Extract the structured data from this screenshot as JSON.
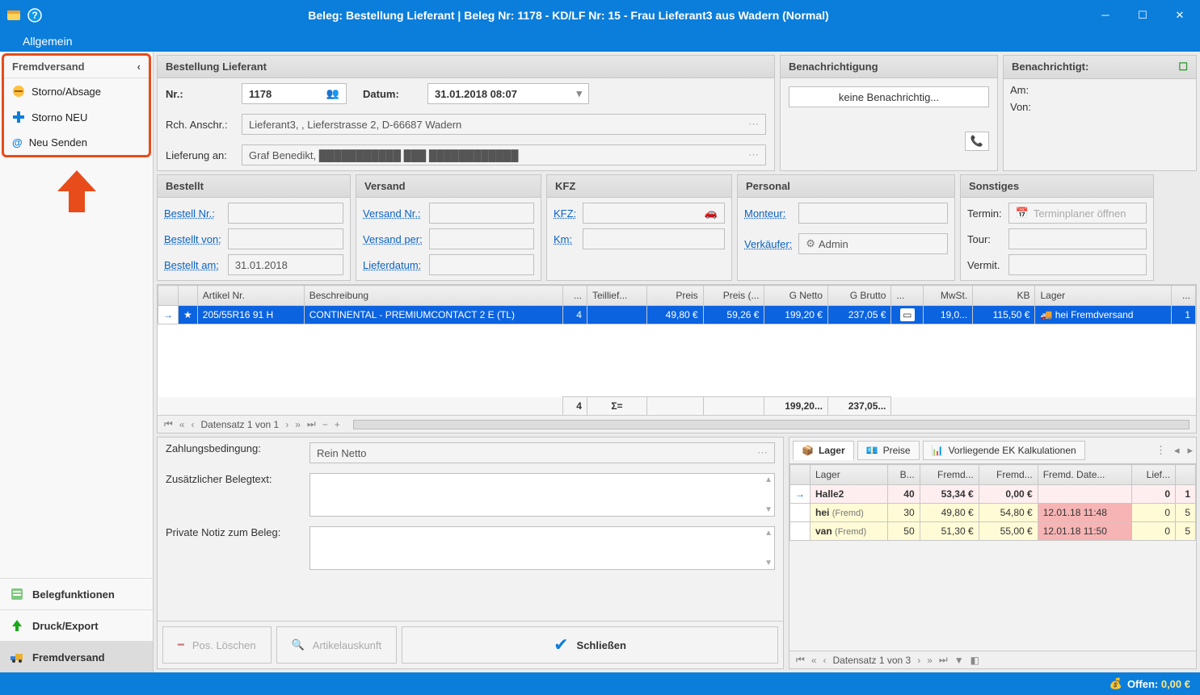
{
  "titlebar": {
    "title": "Beleg: Bestellung Lieferant  |  Beleg Nr: 1178 -  KD/LF Nr: 15 - Frau Lieferant3  aus Wadern (Normal)"
  },
  "ribbon": {
    "tab_general": "Allgemein"
  },
  "sidebar": {
    "header": "Fremdversand",
    "items": [
      {
        "icon": "cancel-icon",
        "label": "Storno/Absage"
      },
      {
        "icon": "plus-icon",
        "label": "Storno NEU"
      },
      {
        "icon": "at-icon",
        "label": "Neu Senden"
      }
    ],
    "bottom": [
      {
        "icon": "doc-icon",
        "label": "Belegfunktionen"
      },
      {
        "icon": "print-icon",
        "label": "Druck/Export"
      },
      {
        "icon": "truck-icon",
        "label": "Fremdversand",
        "active": true
      }
    ]
  },
  "header_panel": {
    "title": "Bestellung Lieferant",
    "nr_label": "Nr.:",
    "nr_value": "1178",
    "datum_label": "Datum:",
    "datum_value": "31.01.2018 08:07",
    "rch_label": "Rch. Anschr.:",
    "rch_value": "Lieferant3, , Lieferstrasse 2,  D-66687 Wadern",
    "lieferung_label": "Lieferung an:",
    "lieferung_value": "Graf Benedikt,  ███████████  ███  ████████████"
  },
  "benachr": {
    "title": "Benachrichtigung",
    "button": "keine Benachrichtig..."
  },
  "benachrigtigt": {
    "title": "Benachrichtigt:",
    "am_label": "Am:",
    "von_label": "Von:"
  },
  "bestellt": {
    "title": "Bestellt",
    "nr_label": "Bestell Nr.:",
    "von_label": "Bestellt von:",
    "am_label": "Bestellt am:",
    "am_value": "31.01.2018"
  },
  "versand": {
    "title": "Versand",
    "nr_label": "Versand Nr.:",
    "per_label": "Versand per:",
    "lieferdatum_label": "Lieferdatum:"
  },
  "kfz": {
    "title": "KFZ",
    "kfz_label": "KFZ:",
    "km_label": "Km:"
  },
  "personal": {
    "title": "Personal",
    "monteur_label": "Monteur:",
    "verkaeufer_label": "Verkäufer:",
    "verkaeufer_value": "Admin"
  },
  "sonstiges": {
    "title": "Sonstiges",
    "termin_label": "Termin:",
    "termin_placeholder": "Terminplaner öffnen",
    "tour_label": "Tour:",
    "vermit_label": "Vermit."
  },
  "main_grid": {
    "cols": [
      "",
      "",
      "Artikel Nr.",
      "Beschreibung",
      "...",
      "Teillief...",
      "Preis",
      "Preis (...",
      "G Netto",
      "G Brutto",
      "...",
      "MwSt.",
      "KB",
      "Lager",
      "..."
    ],
    "row": {
      "artikel": "205/55R16 91 H",
      "beschr": "CONTINENTAL - PREMIUMCONTACT 2 E (TL)",
      "menge": "4",
      "teil": "",
      "preis": "49,80 €",
      "preis2": "59,26 €",
      "gnetto": "199,20 €",
      "gbrutto": "237,05 €",
      "mwst": "19,0...",
      "kb": "115,50 €",
      "lager": "hei Fremdversand",
      "last": "1"
    },
    "sum": {
      "menge": "4",
      "sigma": "Σ=",
      "gnetto": "199,20...",
      "gbrutto": "237,05..."
    },
    "nav": "Datensatz 1 von 1"
  },
  "bform": {
    "zb_label": "Zahlungsbedingung:",
    "zb_value": "Rein Netto",
    "zbt_label": "Zusätzlicher Belegtext:",
    "pn_label": "Private Notiz zum Beleg:",
    "btn_pos": "Pos. Löschen",
    "btn_art": "Artikelauskunft",
    "btn_close": "Schließen"
  },
  "rtabs": {
    "lager": "Lager",
    "preise": "Preise",
    "ek": "Vorliegende EK Kalkulationen"
  },
  "rgrid": {
    "cols": [
      "",
      "Lager",
      "B...",
      "Fremd...",
      "Fremd...",
      "Fremd. Date...",
      "Lief...",
      ""
    ],
    "rows": [
      {
        "cls": "h2",
        "arrow": "→",
        "lager": "Halle2",
        "b": "40",
        "f1": "53,34 €",
        "f2": "0,00 €",
        "fd": "",
        "lf": "0",
        "last": "1"
      },
      {
        "cls": "y",
        "arrow": "",
        "lager": "hei",
        "suffix": "(Fremd)",
        "b": "30",
        "f1": "49,80 €",
        "f2": "54,80 €",
        "fd": "12.01.18 11:48",
        "lf": "0",
        "last": "5"
      },
      {
        "cls": "y",
        "arrow": "",
        "lager": "van",
        "suffix": "(Fremd)",
        "b": "50",
        "f1": "51,30 €",
        "f2": "55,00 €",
        "fd": "12.01.18 11:50",
        "lf": "0",
        "last": "5"
      }
    ],
    "nav": "Datensatz 1 von 3"
  },
  "status": {
    "offen_label": "Offen:",
    "offen_value": "0,00 €"
  }
}
